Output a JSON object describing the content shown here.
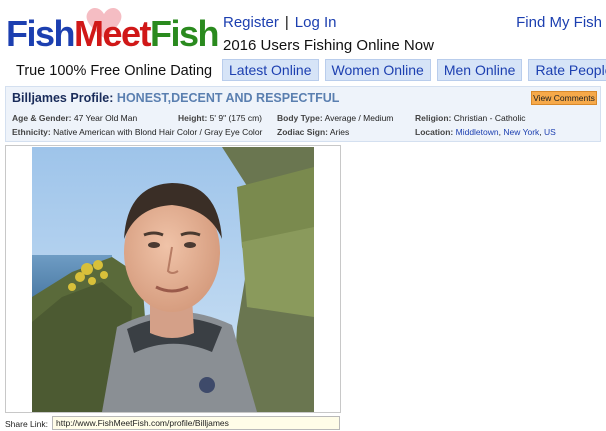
{
  "header": {
    "logo": {
      "part1": "Fish",
      "part2": "Meet",
      "part3": "Fish",
      "alt": "FishMeetFish logo"
    },
    "tagline": "True 100% Free Online Dating",
    "links": {
      "register": "Register",
      "separator": "|",
      "login": "Log In",
      "find": "Find My Fish"
    },
    "users_online": "2016 Users Fishing Online Now",
    "tabs": [
      "Latest Online",
      "Women Online",
      "Men Online",
      "Rate People"
    ]
  },
  "profile": {
    "username_label": "Billjames Profile:",
    "headline": "HONEST,DECENT AND RESPECTFUL",
    "view_comments": "View Comments",
    "fields": {
      "age_gender": {
        "label": "Age & Gender:",
        "value": "47 Year Old Man"
      },
      "height": {
        "label": "Height:",
        "value": "5' 9\" (175 cm)"
      },
      "body_type": {
        "label": "Body Type:",
        "value": "Average / Medium"
      },
      "religion": {
        "label": "Religion:",
        "value": "Christian - Catholic"
      },
      "ethnicity": {
        "label": "Ethnicity:",
        "value": "Native American with Blond Hair Color / Gray Eye Color"
      },
      "zodiac": {
        "label": "Zodiac Sign:",
        "value": "Aries"
      },
      "location": {
        "label": "Location:",
        "city": "Middletown",
        "comma": ",",
        "state": "New York",
        "sep": ",",
        "country": "US"
      }
    }
  },
  "share": {
    "label": "Share Link:",
    "url": "http://www.FishMeetFish.com/profile/Billjames"
  },
  "colors": {
    "brand_blue": "#1c3fb0",
    "brand_red": "#d01818",
    "brand_green": "#2a8a1e",
    "tab_bg": "#d6e4f7",
    "button_orange": "#f6a94a"
  }
}
